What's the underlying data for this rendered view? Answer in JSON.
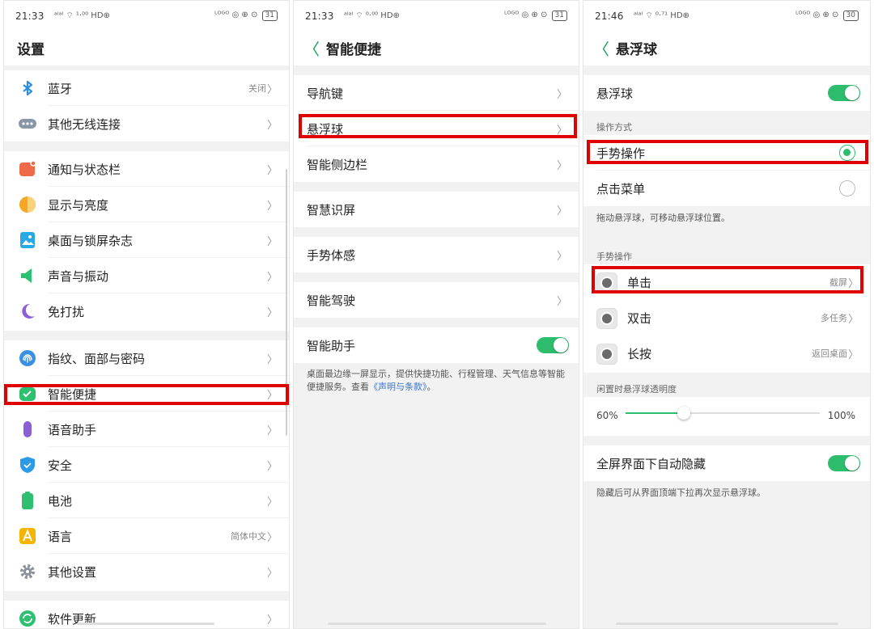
{
  "status": {
    "panel1": {
      "time": "21:33",
      "left_icons": "ᵃˡᵃˡ ⌔ ¹·⁰⁰ HD⊕",
      "right_icons": "ᴸᴼᴳᴼ ◎ ⊕ ⊙",
      "battery": "31"
    },
    "panel2": {
      "time": "21:33",
      "left_icons": "ᵃˡᵃˡ ⌔ ⁰·⁰⁰ HD⊕",
      "right_icons": "ᴸᴼᴳᴼ ◎ ⊕ ⊙",
      "battery": "31"
    },
    "panel3": {
      "time": "21:46",
      "left_icons": "ᵃˡᵃˡ ⌔ ⁰·⁷¹ HD⊕",
      "right_icons": "ᴸᴼᴳᴼ ◎ ⊕ ⊙",
      "battery": "30"
    }
  },
  "settings": {
    "title": "设置",
    "items": [
      {
        "label": "蓝牙",
        "value": "关闭"
      },
      {
        "label": "其他无线连接"
      },
      {
        "label": "通知与状态栏"
      },
      {
        "label": "显示与亮度"
      },
      {
        "label": "桌面与锁屏杂志"
      },
      {
        "label": "声音与振动"
      },
      {
        "label": "免打扰"
      },
      {
        "label": "指纹、面部与密码"
      },
      {
        "label": "智能便捷"
      },
      {
        "label": "语音助手"
      },
      {
        "label": "安全"
      },
      {
        "label": "电池"
      },
      {
        "label": "语言",
        "value": "简体中文"
      },
      {
        "label": "其他设置"
      },
      {
        "label": "软件更新"
      }
    ],
    "chevron": "〉"
  },
  "smart": {
    "title": "智能便捷",
    "back": "〈",
    "items": [
      {
        "label": "导航键"
      },
      {
        "label": "悬浮球"
      },
      {
        "label": "智能侧边栏"
      },
      {
        "label": "智慧识屏"
      },
      {
        "label": "手势体感"
      },
      {
        "label": "智能驾驶"
      },
      {
        "label": "智能助手"
      }
    ],
    "assistant_note_prefix": "桌面最边缘一屏显示，提供快捷功能、行程管理、天气信息等智能便捷服务。查看",
    "assistant_note_link": "《声明与条款》",
    "assistant_note_suffix": "。"
  },
  "floatball": {
    "title": "悬浮球",
    "back": "〈",
    "toggle_label": "悬浮球",
    "mode_section": "操作方式",
    "mode_gesture": "手势操作",
    "mode_menu": "点击菜单",
    "mode_note": "拖动悬浮球，可移动悬浮球位置。",
    "gesture_section": "手势操作",
    "gestures": [
      {
        "label": "单击",
        "value": "截屏"
      },
      {
        "label": "双击",
        "value": "多任务"
      },
      {
        "label": "长按",
        "value": "返回桌面"
      }
    ],
    "opacity_section": "闲置时悬浮球透明度",
    "opacity_min": "60%",
    "opacity_max": "100%",
    "opacity_value": 0.3,
    "autohide_label": "全屏界面下自动隐藏",
    "autohide_note": "隐藏后可从界面顶端下拉再次显示悬浮球。"
  },
  "colors": {
    "accent": "#2ebd6d",
    "highlight": "#e00000",
    "link": "#3b74c9"
  },
  "icons": [
    "bluetooth-icon",
    "more-connections-icon",
    "notification-icon",
    "display-icon",
    "wallpaper-icon",
    "sound-icon",
    "do-not-disturb-icon",
    "fingerprint-icon",
    "smart-icon",
    "voice-assistant-icon",
    "security-icon",
    "battery-icon",
    "language-icon",
    "gear-icon",
    "update-icon"
  ]
}
